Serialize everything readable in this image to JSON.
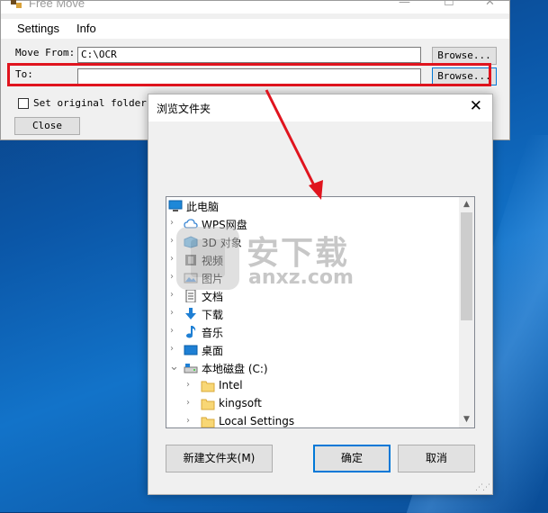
{
  "app": {
    "title": "Free Move",
    "menu": [
      "Settings",
      "Info"
    ],
    "move_from_label": "Move From:",
    "move_from_value": "C:\\OCR",
    "to_label": "To:",
    "to_value": "",
    "browse_label": "Browse...",
    "set_original_label": "Set original folder to",
    "close_label": "Close",
    "controls": {
      "minimize": "—",
      "maximize": "☐",
      "close": "✕"
    }
  },
  "dialog": {
    "title": "浏览文件夹",
    "close_glyph": "✕",
    "tree": [
      {
        "label": "此电脑",
        "icon": "computer-icon",
        "level": 0,
        "chevron": ""
      },
      {
        "label": "WPS网盘",
        "icon": "cloud-icon",
        "level": 1,
        "chevron": "›"
      },
      {
        "label": "3D 对象",
        "icon": "3d-objects-icon",
        "level": 1,
        "chevron": "›"
      },
      {
        "label": "视频",
        "icon": "video-icon",
        "level": 1,
        "chevron": "›"
      },
      {
        "label": "图片",
        "icon": "pictures-icon",
        "level": 1,
        "chevron": "›"
      },
      {
        "label": "文档",
        "icon": "documents-icon",
        "level": 1,
        "chevron": "›"
      },
      {
        "label": "下载",
        "icon": "download-icon",
        "level": 1,
        "chevron": "›"
      },
      {
        "label": "音乐",
        "icon": "music-icon",
        "level": 1,
        "chevron": "›"
      },
      {
        "label": "桌面",
        "icon": "desktop-icon",
        "level": 1,
        "chevron": "›"
      },
      {
        "label": "本地磁盘 (C:)",
        "icon": "drive-icon",
        "level": 1,
        "chevron": "⌄"
      },
      {
        "label": "Intel",
        "icon": "folder-icon",
        "level": 2,
        "chevron": "›"
      },
      {
        "label": "kingsoft",
        "icon": "folder-icon",
        "level": 2,
        "chevron": "›"
      },
      {
        "label": "Local Settings",
        "icon": "folder-icon",
        "level": 2,
        "chevron": "›"
      }
    ],
    "new_folder_label": "新建文件夹(M)",
    "ok_label": "确定",
    "cancel_label": "取消"
  },
  "watermark": {
    "cn": "安下载",
    "en": "anxz.com"
  },
  "colors": {
    "highlight": "#e0141e",
    "accent": "#0078d7",
    "folder": "#f8d775"
  }
}
